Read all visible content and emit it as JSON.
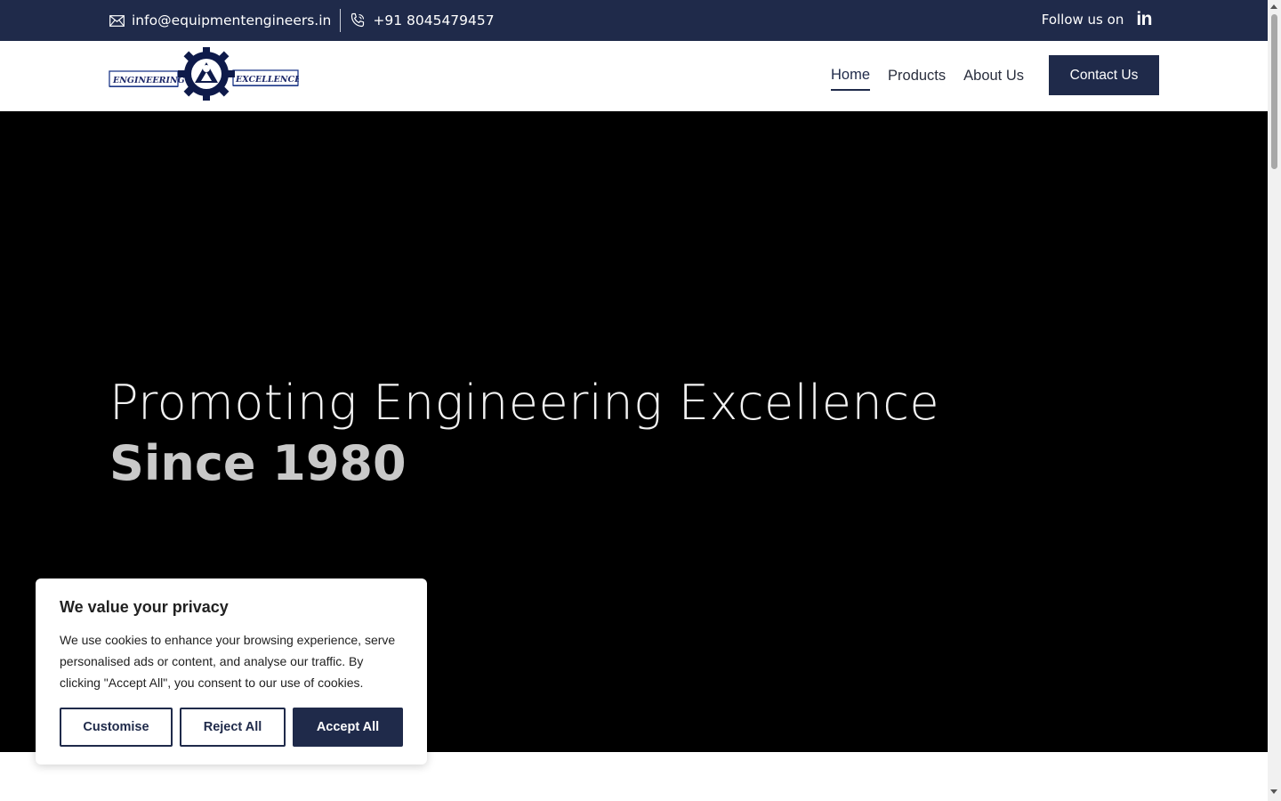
{
  "topbar": {
    "email": "info@equipmentengineers.in",
    "phone": "+91 8045479457",
    "follow_label": "Follow us on",
    "linkedin_glyph": "in",
    "icons": {
      "email": "mail-icon",
      "phone": "phone-icon",
      "social": "linkedin-icon"
    }
  },
  "logo": {
    "left_text": "ENGINEERING",
    "right_text": "EXCELLENCE"
  },
  "nav": {
    "items": [
      {
        "label": "Home",
        "active": true
      },
      {
        "label": "Products",
        "active": false
      },
      {
        "label": "About Us",
        "active": false
      }
    ],
    "cta_label": "Contact Us"
  },
  "hero": {
    "line1": "Promoting Engineering Excellence",
    "line2": "Since 1980"
  },
  "cookie": {
    "title": "We value your privacy",
    "body": "We use cookies to enhance your browsing experience, serve personalised ads or content, and analyse our traffic. By clicking \"Accept All\", you consent to our use of cookies.",
    "customise_label": "Customise",
    "reject_label": "Reject All",
    "accept_label": "Accept All"
  },
  "colors": {
    "brand_navy": "#1f2a4a",
    "hero_bg": "#000000"
  }
}
